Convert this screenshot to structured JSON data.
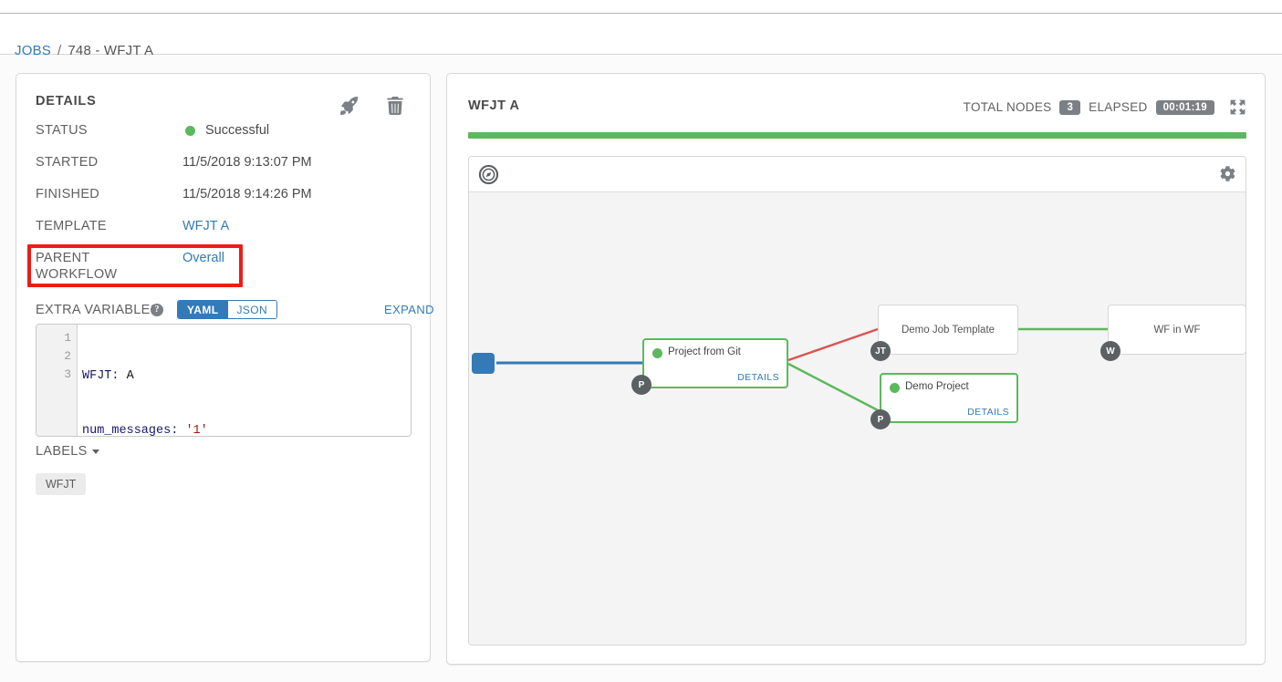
{
  "breadcrumb": {
    "root_label": "JOBS",
    "separator": "/",
    "current_label": "748 - WFJT A"
  },
  "details": {
    "title": "DETAILS",
    "relaunch_icon": "rocket-icon",
    "delete_icon": "trash-icon",
    "rows": {
      "status_label": "STATUS",
      "status_value": "Successful",
      "status_color": "#5cb85c",
      "started_label": "STARTED",
      "started_value": "11/5/2018 9:13:07 PM",
      "finished_label": "FINISHED",
      "finished_value": "11/5/2018 9:14:26 PM",
      "template_label": "TEMPLATE",
      "template_value": "WFJT A",
      "parent_label_line1": "PARENT",
      "parent_label_line2": "WORKFLOW",
      "parent_value": "Overall"
    },
    "highlight_color": "#ee1c16",
    "extra_variables": {
      "label": "EXTRA VARIABLES",
      "help_glyph": "?",
      "toggle_yaml": "YAML",
      "toggle_json": "JSON",
      "active_toggle": "YAML",
      "expand_label": "EXPAND",
      "line_numbers": [
        "1",
        "2",
        "3"
      ],
      "lines": [
        {
          "key": "WFJT:",
          "plain": " A",
          "string": ""
        },
        {
          "key": "num_messages:",
          "plain": " ",
          "string": "'1'"
        },
        {
          "key": "",
          "plain": "",
          "string": ""
        }
      ]
    },
    "labels": {
      "header": "LABELS",
      "chips": [
        "WFJT"
      ]
    }
  },
  "graph": {
    "title": "WFJT A",
    "total_nodes_label": "TOTAL NODES",
    "total_nodes_value": "3",
    "elapsed_label": "ELAPSED",
    "elapsed_value": "00:01:19",
    "fullscreen_icon": "expand-arrows-icon",
    "compass_icon": "compass-icon",
    "settings_icon": "gear-icon",
    "progress_color": "#5cb85c",
    "details_link_label": "DETAILS",
    "nodes": [
      {
        "id": "start",
        "type": "start",
        "label": ""
      },
      {
        "id": "project-from-git",
        "label": "Project from Git",
        "badge": "P",
        "status": "success",
        "has_details": true,
        "style": "green"
      },
      {
        "id": "demo-job-template",
        "label": "Demo Job Template",
        "badge": "JT",
        "status": "none",
        "has_details": false,
        "style": "plain"
      },
      {
        "id": "demo-project",
        "label": "Demo Project",
        "badge": "P",
        "status": "success",
        "has_details": true,
        "style": "green"
      },
      {
        "id": "wf-in-wf",
        "label": "WF in WF",
        "badge": "W",
        "status": "none",
        "has_details": false,
        "style": "plain"
      }
    ],
    "edges": [
      {
        "from": "start",
        "to": "project-from-git",
        "color": "#337ab7"
      },
      {
        "from": "project-from-git",
        "to": "demo-job-template",
        "color": "#d9534f"
      },
      {
        "from": "project-from-git",
        "to": "demo-project",
        "color": "#5cb85c"
      },
      {
        "from": "demo-job-template",
        "to": "wf-in-wf",
        "color": "#5cb85c"
      }
    ]
  }
}
